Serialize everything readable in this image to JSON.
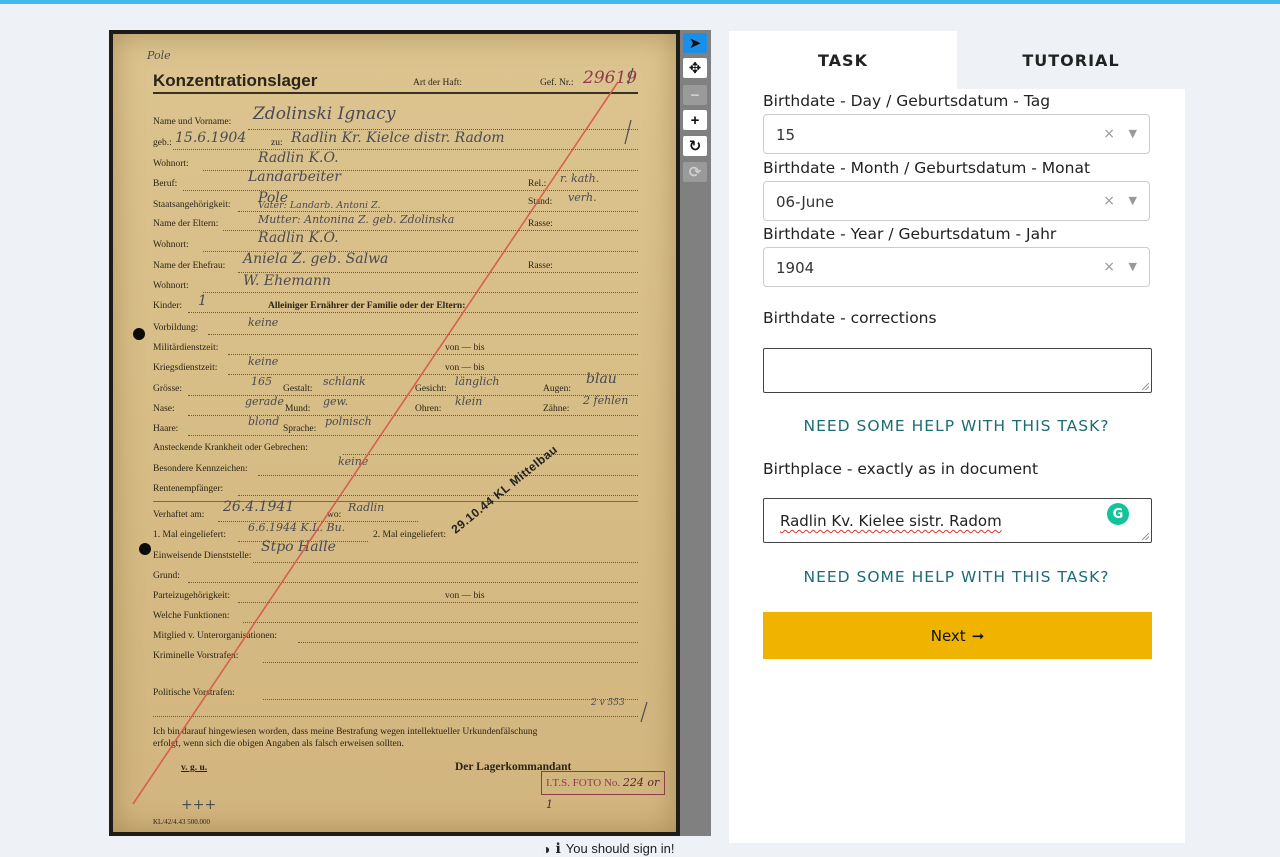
{
  "document": {
    "header_note": "Pole",
    "title": "Konzentrationslager",
    "art_der_haft": "Art der Haft:",
    "gef_nr_label": "Gef. Nr.:",
    "gef_nr": "29619",
    "fields": {
      "name_label": "Name und Vorname:",
      "name_value": "Zdolinski Ignacy",
      "geb_label": "geb.:",
      "geb_value": "15.6.1904",
      "zu_label": "zu:",
      "zu_value": "Radlin Kr. Kielce distr. Radom",
      "wohnort_label": "Wohnort:",
      "wohnort_value": "Radlin K.O.",
      "beruf_label": "Beruf:",
      "beruf_value": "Landarbeiter",
      "rel_label": "Rel.:",
      "rel_value": "r. kath.",
      "staat_label": "Staatsangehörigkeit:",
      "staat_value": "Pole",
      "stand_label": "Stand:",
      "stand_value": "verh.",
      "eltern_label": "Name der Eltern:",
      "eltern_value_1": "Vater: Landarb. Antoni Z.",
      "eltern_value_2": "Mutter: Antonina Z. geb. Zdolinska",
      "rasse_label": "Rasse:",
      "wohnort2_label": "Wohnort:",
      "wohnort2_value": "Radlin K.O.",
      "ehefrau_label": "Name der Ehefrau:",
      "ehefrau_value": "Aniela Z. geb. Salwa",
      "rasse2_label": "Rasse:",
      "wohnort3_label": "Wohnort:",
      "wohnort3_value": "W. Ehemann",
      "kinder_label": "Kinder:",
      "kinder_value": "1",
      "ernaehrer_label": "Alleiniger Ernährer der Familie oder der Eltern:",
      "vorbildung_label": "Vorbildung:",
      "vorbildung_value": "keine",
      "militaer_label": "Militärdienstzeit:",
      "vonbis_label": "von — bis",
      "krieg_label": "Kriegsdienstzeit:",
      "krieg_value": "keine",
      "groesse_label": "Grösse:",
      "groesse_value": "165",
      "gestalt_label": "Gestalt:",
      "gestalt_value": "schlank",
      "gesicht_label": "Gesicht:",
      "gesicht_value": "länglich",
      "augen_label": "Augen:",
      "augen_value": "blau",
      "nase_label": "Nase:",
      "nase_value": "gerade",
      "mund_label": "Mund:",
      "mund_value": "gew.",
      "ohren_label": "Ohren:",
      "ohren_value": "klein",
      "zaehne_label": "Zähne:",
      "zaehne_value": "2 fehlen",
      "haare_label": "Haare:",
      "haare_value": "blond",
      "sprache_label": "Sprache:",
      "sprache_value": "polnisch",
      "krankheit_label": "Ansteckende Krankheit oder Gebrechen:",
      "kennzeichen_label": "Besondere Kennzeichen:",
      "kennzeichen_value": "keine",
      "renten_label": "Rentenempfänger:",
      "verhaftet_label": "Verhaftet am:",
      "verhaftet_value": "26.4.1941",
      "wo_label": "wo:",
      "wo_value": "Radlin",
      "mal1_label": "1. Mal eingeliefert:",
      "mal1_value": "6.6.1944 K.L. Bu.",
      "mal2_label": "2. Mal eingeliefert:",
      "dienst_label": "Einweisende Dienststelle:",
      "dienst_value": "Stpo Halle",
      "grund_label": "Grund:",
      "partei_label": "Parteizugehörigkeit:",
      "partei_vonbis": "von — bis",
      "funktionen_label": "Welche Funktionen:",
      "mitglied_label": "Mitglied v. Unterorganisationen:",
      "kriminelle_label": "Kriminelle Vorstrafen:",
      "politische_label": "Politische Vorstrafen:",
      "vorstrafen_note": "2 v 553",
      "declaration_1": "Ich bin darauf hingewiesen worden, dass meine Bestrafung wegen intellektueller Urkundenfälschung",
      "declaration_2": "erfolgt, wenn sich die obigen Angaben als falsch erweisen sollten.",
      "vgu": "v. g. u.",
      "kommandant": "Der Lagerkommandant",
      "its_stamp": "I.T.S. FOTO No.",
      "its_number": "224 or 1",
      "signature": "+++",
      "footer_code": "KL/42/4.43 500.000"
    },
    "stamp_text": "29.10.44 KL Mittelbau"
  },
  "viewer_tools": [
    {
      "name": "pointer",
      "glyph": "➤"
    },
    {
      "name": "move",
      "glyph": "✥"
    },
    {
      "name": "zoom-out",
      "glyph": "−"
    },
    {
      "name": "zoom-in",
      "glyph": "+"
    },
    {
      "name": "rotate",
      "glyph": "↻"
    },
    {
      "name": "reset",
      "glyph": "⟳"
    }
  ],
  "signin": {
    "text": "You should sign in!"
  },
  "panel": {
    "tabs": {
      "task": "TASK",
      "tutorial": "TUTORIAL"
    },
    "birth_day": {
      "label": "Birthdate - Day / Geburtsdatum - Tag",
      "value": "15"
    },
    "birth_month": {
      "label": "Birthdate - Month / Geburtsdatum - Monat",
      "value": "06-June"
    },
    "birth_year": {
      "label": "Birthdate - Year / Geburtsdatum - Jahr",
      "value": "1904"
    },
    "clear_glyph": "×",
    "arrow_glyph": "▼",
    "corrections": {
      "label": "Birthdate - corrections",
      "value": ""
    },
    "help_1": "NEED SOME HELP WITH THIS TASK?",
    "birthplace": {
      "label": "Birthplace - exactly as in document",
      "value": "Radlin Kv. Kielee sistr. Radom"
    },
    "grammarly": "G",
    "help_2": "NEED SOME HELP WITH THIS TASK?",
    "next": {
      "label": "Next",
      "arrow": "➞"
    }
  },
  "colors": {
    "accent": "#43b7f0",
    "next_button": "#f0b400",
    "help_link": "#1c6c74"
  }
}
